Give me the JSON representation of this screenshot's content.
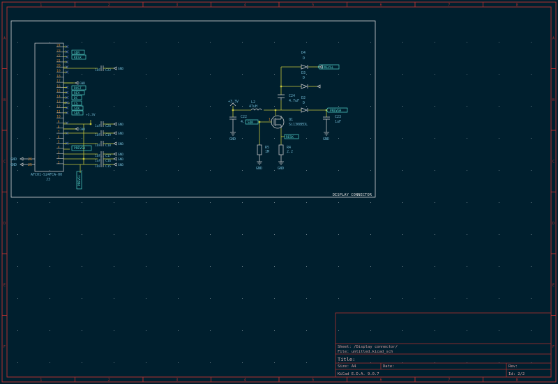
{
  "frame": {
    "col_labels": [
      "1",
      "2",
      "3",
      "4",
      "5",
      "6",
      "7",
      "8"
    ],
    "row_labels": [
      "A",
      "B",
      "C",
      "D",
      "E",
      "F"
    ]
  },
  "block": {
    "title": "DISPLAY CONNECTOR"
  },
  "connector": {
    "ref": "J3",
    "value": "AFC01-S24FCA-00",
    "pins_left": [
      "24",
      "23",
      "22",
      "21",
      "20",
      "19",
      "18",
      "17",
      "16",
      "15",
      "14",
      "13",
      "12",
      "11",
      "10",
      "9",
      "8",
      "7",
      "6",
      "5",
      "4",
      "3",
      "2",
      "1"
    ],
    "pins_side": [
      "26",
      "25"
    ],
    "gnd_left": [
      "GND",
      "GND"
    ]
  },
  "labels": {
    "sdr": "SDR",
    "resx": "RESX",
    "rust": "RUST",
    "rex": "REX",
    "dc": "DC",
    "cs": "CS",
    "sck": "SCK",
    "sda": "SDA",
    "prevgh": "PREVGH",
    "prevgl": "PREVGL",
    "resk": "RESK",
    "v33": "+3.3V"
  },
  "left_caps": [
    {
      "ref": "C22",
      "value": "1UF"
    },
    {
      "ref": "C20",
      "value": "1uF"
    },
    {
      "ref": "C19",
      "value": "1UF"
    },
    {
      "ref": "C18",
      "value": "1UF"
    },
    {
      "ref": "C17",
      "value": "1UF"
    },
    {
      "ref": "C16",
      "value": "1uF"
    },
    {
      "ref": "C15",
      "value": "1UF"
    }
  ],
  "gnd": "GND",
  "power_circuit": {
    "v33": "+3.3V",
    "l2_ref": "L2",
    "l2_val": "47uH",
    "c22_ref": "C22",
    "c22_val": "4.",
    "c24_ref": "C24",
    "c24_val": "4.7uF",
    "c23_ref": "C23",
    "c23_val": "1uF",
    "d4_ref": "D4",
    "d4_val": "D",
    "d3_ref": "D3",
    "d3_val": "D",
    "d2_ref": "D2",
    "d2_val": "D",
    "q1_ref": "Q1",
    "q1_val": "Si1308EDL",
    "r5_ref": "R5",
    "r5_val": "1M",
    "r4_ref": "R4",
    "r4_val": "2.2",
    "pin1": "1"
  },
  "title_block": {
    "sheet": "Sheet: /Display connector/",
    "file": "File: untitled.kicad_sch",
    "title": "Title:",
    "size": "Size: A4",
    "date": "Date:",
    "rev": "Rev:",
    "tool": "KiCad E.D.A. 9.0.7",
    "id": "Id: 2/2"
  },
  "colors": {
    "background": "#001f2e",
    "frame": "#b03030",
    "wire": "#c8c83c",
    "text": "#6fb6d0",
    "pin_number": "#c87a22",
    "label": "#52d0c8",
    "component": "#c8c8c8"
  }
}
